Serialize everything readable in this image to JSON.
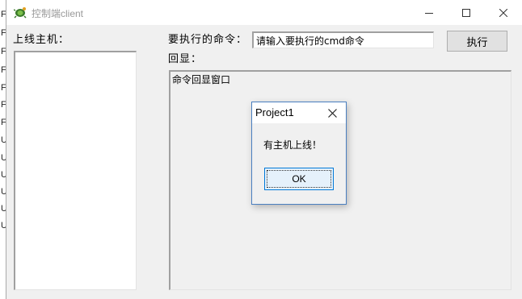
{
  "background_window": {
    "edge_letters": [
      "F",
      "F",
      "F",
      "F",
      "F",
      "F",
      "F",
      "U",
      "U",
      "U",
      "U",
      "U",
      "U"
    ]
  },
  "main_window": {
    "title": "控制端client",
    "app_icon": "turtle-app-icon",
    "controls": {
      "minimize_icon": "minimize-icon",
      "maximize_icon": "maximize-icon",
      "close_icon": "close-icon"
    }
  },
  "hosts": {
    "label": "上线主机：",
    "items": []
  },
  "command": {
    "label": "要执行的命令：",
    "value": "请输入要执行的cmd命令",
    "execute_label": "执行"
  },
  "echo": {
    "label": "回显：",
    "content": "命令回显窗口"
  },
  "message_box": {
    "title": "Project1",
    "message": "有主机上线！",
    "ok_label": "OK",
    "close_icon": "close-icon"
  }
}
